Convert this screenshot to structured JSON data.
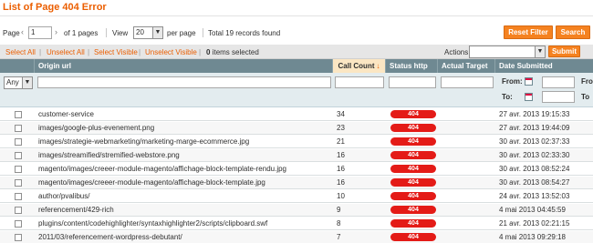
{
  "header": {
    "title": "List of Page 404 Error"
  },
  "pager": {
    "page_label": "Page",
    "page_value": "1",
    "of_pages": "of 1 pages",
    "view_label": "View",
    "per_page_value": "20",
    "per_page_label": "per page",
    "total": "Total 19 records found"
  },
  "buttons": {
    "reset_filter": "Reset Filter",
    "search": "Search",
    "submit": "Submit"
  },
  "massaction": {
    "select_all": "Select All",
    "unselect_all": "Unselect All",
    "select_visible": "Select Visible",
    "unselect_visible": "Unselect Visible",
    "items_count": "0",
    "items_label": "items selected",
    "actions_label": "Actions",
    "pipe": "|"
  },
  "columns": {
    "origin_url": "Origin url",
    "call_count": "Call Count",
    "status_http": "Status http",
    "actual_target": "Actual Target",
    "date_submitted": "Date Submitted"
  },
  "filters": {
    "any": "Any",
    "from_label": "From:",
    "to_label": "To:",
    "from_short": "From",
    "to_short": "To"
  },
  "rows": [
    {
      "url": "customer-service",
      "count": "34",
      "status": "404",
      "date": "27 avr. 2013 19:15:33"
    },
    {
      "url": "images/google-plus-evenement.png",
      "count": "23",
      "status": "404",
      "date": "27 avr. 2013 19:44:09"
    },
    {
      "url": "images/strategie-webmarketing/marketing-marge-ecommerce.jpg",
      "count": "21",
      "status": "404",
      "date": "30 avr. 2013 02:37:33"
    },
    {
      "url": "images/streamified/stremified-webstore.png",
      "count": "16",
      "status": "404",
      "date": "30 avr. 2013 02:33:30"
    },
    {
      "url": "magento/images/creeer-module-magento/affichage-block-template-rendu.jpg",
      "count": "16",
      "status": "404",
      "date": "30 avr. 2013 08:52:24"
    },
    {
      "url": "magento/images/creeer-module-magento/affichage-block-template.jpg",
      "count": "16",
      "status": "404",
      "date": "30 avr. 2013 08:54:27"
    },
    {
      "url": "author/pvalibus/",
      "count": "10",
      "status": "404",
      "date": "24 avr. 2013 13:52:03"
    },
    {
      "url": "referencement/429-rich",
      "count": "9",
      "status": "404",
      "date": "4 mai 2013 04:45:59"
    },
    {
      "url": "plugins/content/codehighlighter/syntaxhighlighter2/scripts/clipboard.swf",
      "count": "8",
      "status": "404",
      "date": "21 avr. 2013 02:21:15"
    },
    {
      "url": "2011/03/referencement-wordpress-debutant/",
      "count": "7",
      "status": "404",
      "date": "4 mai 2013 09:29:18"
    }
  ],
  "colors": {
    "accent": "#eb5e00",
    "button": "#f58220",
    "header_bg": "#6f8992",
    "badge": "#e41b17"
  },
  "icons": {
    "sort": "sort-desc-arrow",
    "calendar": "calendar-icon",
    "dropdown": "chevron-down-icon"
  }
}
